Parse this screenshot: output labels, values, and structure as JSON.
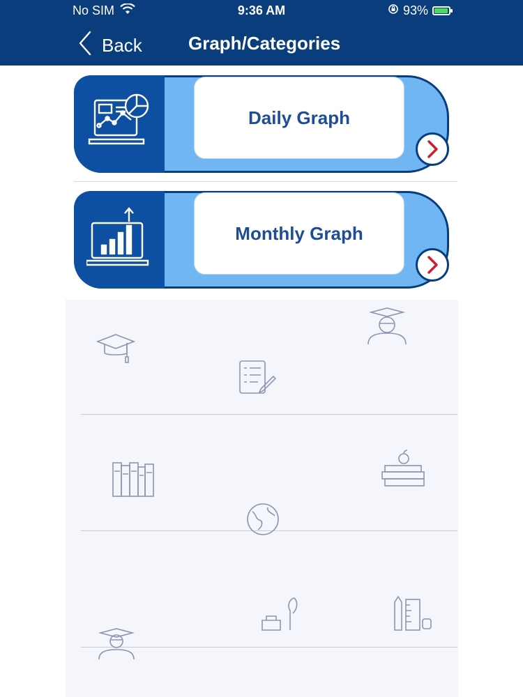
{
  "status_bar": {
    "carrier": "No SIM",
    "time": "9:36 AM",
    "battery": "93%",
    "battery_level": 0.93
  },
  "nav": {
    "back_label": "Back",
    "title": "Graph/Categories"
  },
  "categories": [
    {
      "label": "Daily Graph",
      "icon": "laptop-chart-icon"
    },
    {
      "label": "Monthly Graph",
      "icon": "laptop-bar-chart-icon"
    }
  ],
  "background_icons": [
    "graduation-cap-icon",
    "checklist-icon",
    "graduate-student-icon",
    "books-icon",
    "globe-icon",
    "apple-books-icon",
    "graduate-icon",
    "inkwell-feather-icon",
    "ruler-pencil-icon"
  ],
  "colors": {
    "header": "#0a3d7c",
    "card_accent": "#6fb6f2",
    "card_icon_bg": "#0d4fa0",
    "chevron": "#d11a2a"
  }
}
